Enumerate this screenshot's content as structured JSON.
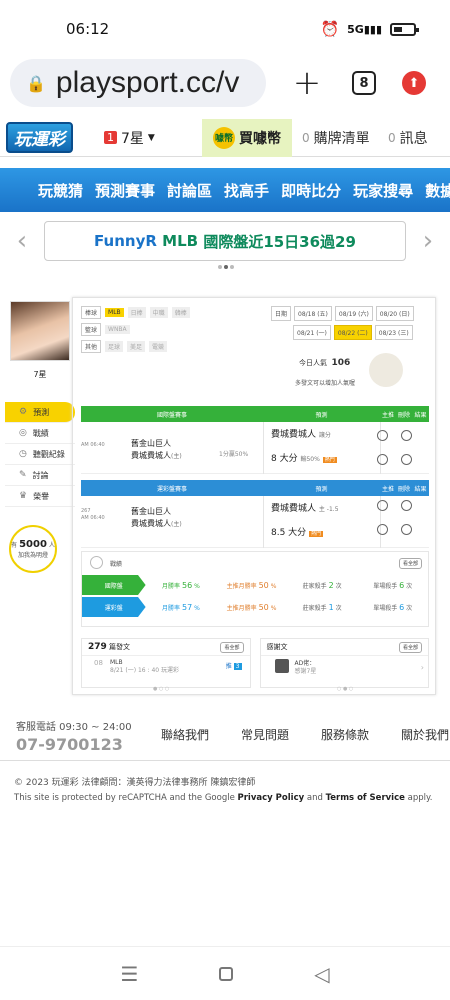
{
  "status": {
    "time": "06:12",
    "icons": [
      "alarm-icon",
      "signal-5g-icon",
      "battery-icon"
    ]
  },
  "browser": {
    "url": "playsport.cc/v",
    "tab_count": "8"
  },
  "site": {
    "logo": "玩運彩",
    "level_badge": "1",
    "level": "7星",
    "buy_coin": "買噱幣",
    "coin_text": "噱幣",
    "cart_count": "0",
    "cart_label": "購牌清單",
    "msg_count": "0",
    "msg_label": "訊息"
  },
  "nav": [
    "玩競猜",
    "預測賽事",
    "討論區",
    "找高手",
    "即時比分",
    "玩家搜尋",
    "數據"
  ],
  "announcement": {
    "user": "FunnyR",
    "league": "MLB",
    "text": "國際盤近15日36過29"
  },
  "user": {
    "name": "7星",
    "menu": [
      {
        "label": "預測",
        "icon": "gear-icon"
      },
      {
        "label": "戰績",
        "icon": "chart-icon"
      },
      {
        "label": "聽觀紀錄",
        "icon": "clock-icon"
      },
      {
        "label": "討論",
        "icon": "chat-icon"
      },
      {
        "label": "榮譽",
        "icon": "trophy-icon"
      }
    ],
    "popularity_prefix": "有",
    "popularity_num": "5000",
    "popularity_suffix": "人",
    "popularity_hint": "加我為明燈"
  },
  "filters": {
    "rows": [
      {
        "label": "棒球",
        "tags": [
          {
            "t": "MLB",
            "on": true
          },
          {
            "t": "日棒",
            "on": false
          },
          {
            "t": "中職",
            "on": false
          },
          {
            "t": "韓棒",
            "on": false
          }
        ]
      },
      {
        "label": "籃球",
        "tags": [
          {
            "t": "WNBA",
            "on": false
          }
        ]
      },
      {
        "label": "其他",
        "tags": [
          {
            "t": "足球",
            "on": false
          },
          {
            "t": "美足",
            "on": false
          },
          {
            "t": "電競",
            "on": false
          }
        ]
      }
    ]
  },
  "dates": {
    "label": "日期",
    "row1": [
      {
        "t": "08/18 (五)",
        "on": false
      },
      {
        "t": "08/19 (六)",
        "on": false
      },
      {
        "t": "08/20 (日)",
        "on": false
      }
    ],
    "row2": [
      {
        "t": "08/21 (一)",
        "on": false
      },
      {
        "t": "08/22 (二)",
        "on": true
      },
      {
        "t": "08/23 (三)",
        "on": false
      }
    ]
  },
  "today_pop": {
    "label": "今日人氣",
    "value": "106",
    "hint": "多發文可以增加人氣喔"
  },
  "intl": {
    "header": {
      "game": "國際盤賽事",
      "pred": "預測",
      "main": "主推",
      "del": "刪除",
      "result": "結果"
    },
    "game": {
      "time": "AM 06:40",
      "away": "舊金山巨人",
      "home": "費城費城人",
      "home_suffix": "(主)",
      "spread": "1分贏50%",
      "pred1_team": "費城費城人",
      "pred1_note": "讓分",
      "pred2_main": "8 大分",
      "pred2_note": "輸50%",
      "hot": "熱門"
    }
  },
  "lottery": {
    "header": {
      "game": "運彩盤賽事",
      "pred": "預測",
      "main": "主推",
      "del": "刪除",
      "result": "結果"
    },
    "game": {
      "id": "267",
      "time": "AM 06:40",
      "away": "舊金山巨人",
      "home": "費城費城人",
      "home_suffix": "(主)",
      "pred1_team": "費城費城人",
      "pred1_note": "主 -1.5",
      "pred2_main": "8.5 大分",
      "hot": "熱門"
    }
  },
  "record": {
    "title": "戰績",
    "see_all": "看全部",
    "rows": [
      {
        "tag": "國際盤",
        "month": "月勝率",
        "month_v": "56",
        "main_month": "主推月勝率",
        "main_month_v": "50",
        "zhuang": "莊家殺手",
        "zhuang_v": "2",
        "single": "單場殺手",
        "single_v": "6",
        "unit": "%",
        "unit2": "次"
      },
      {
        "tag": "運彩盤",
        "month": "月勝率",
        "month_v": "57",
        "main_month": "主推月勝率",
        "main_month_v": "50",
        "zhuang": "莊家殺手",
        "zhuang_v": "1",
        "single": "單場殺手",
        "single_v": "6",
        "unit": "%",
        "unit2": "次"
      }
    ]
  },
  "posts": {
    "count": "279",
    "label": "篇發文",
    "see_all": "看全部",
    "first": {
      "num": "08",
      "board": "MLB",
      "line2": "8/21 (一) 16 : 40 玩運彩",
      "c_label": "推",
      "c_val": "3"
    }
  },
  "replies": {
    "label": "感謝文",
    "see_all": "看全部",
    "first": {
      "name": "AD佬：",
      "text": "感謝7星"
    }
  },
  "footer": {
    "cs_label": "客服電話 09:30 ~ 24:00",
    "cs_phone": "07-9700123",
    "links": [
      "聯絡我們",
      "常見問題",
      "服務條款",
      "關於我們"
    ],
    "copyright": "© 2023 玩運彩 法律顧問：漢英得力法律事務所 陳鎮宏律師",
    "recaptcha_pre": "This site is protected by reCAPTCHA and the Google ",
    "privacy": "Privacy Policy",
    "and": " and ",
    "terms": "Terms of Service",
    "apply": " apply."
  },
  "colors": {
    "nav_blue": "#1a73c8",
    "green": "#35b13a",
    "yellow": "#f8d200",
    "blue": "#2c8ed6"
  }
}
